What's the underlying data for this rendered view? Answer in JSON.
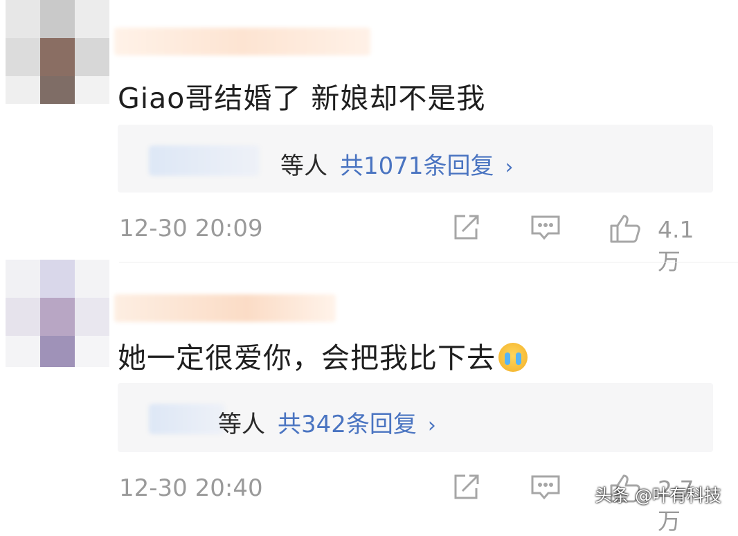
{
  "comments": [
    {
      "text": "Giao哥结婚了 新娘却不是我",
      "reply_suffix": "等人",
      "reply_count": "共1071条回复",
      "reply_chevron": "›",
      "timestamp": "12-30 20:09",
      "likes": "4.1万"
    },
    {
      "text": "她一定很爱你，会把我比下去",
      "emoji_icon": "crying-face-icon",
      "reply_suffix": "等人",
      "reply_count": "共342条回复",
      "reply_chevron": "›",
      "timestamp": "12-30 20:40",
      "likes": "2.7万"
    }
  ],
  "icons": {
    "share": "share-icon",
    "reply": "comment-icon",
    "like": "thumbs-up-icon"
  },
  "colors": {
    "link_blue": "#4a74c1",
    "meta_gray": "#9a9a9a",
    "reply_bg": "#f6f6f7"
  },
  "watermark": "头条 @叶有科技"
}
